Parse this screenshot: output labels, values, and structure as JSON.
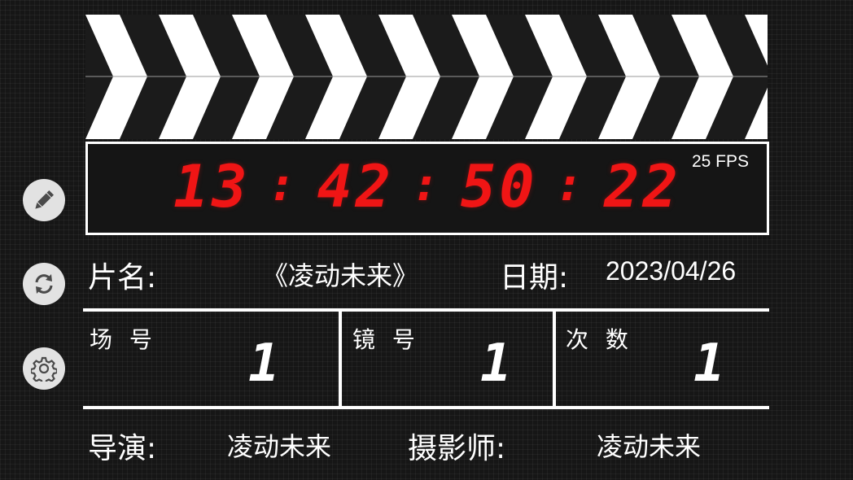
{
  "sidebar": {
    "edit_icon": "pencil-icon",
    "sync_icon": "refresh-icon",
    "settings_icon": "gear-icon"
  },
  "timecode": {
    "hours": "13",
    "minutes": "42",
    "seconds": "50",
    "frames": "22",
    "separator": ":",
    "fps": "25 FPS",
    "color": "#f01515"
  },
  "info": {
    "title_label": "片名:",
    "title_value": "《凌动未来》",
    "date_label": "日期:",
    "date_value": "2023/04/26"
  },
  "grid": {
    "scene_label": "场 号",
    "scene_value": "1",
    "shot_label": "镜 号",
    "shot_value": "1",
    "take_label": "次 数",
    "take_value": "1"
  },
  "crew": {
    "director_label": "导演:",
    "director_value": "凌动未来",
    "camera_label": "摄影师:",
    "camera_value": "凌动未来"
  }
}
